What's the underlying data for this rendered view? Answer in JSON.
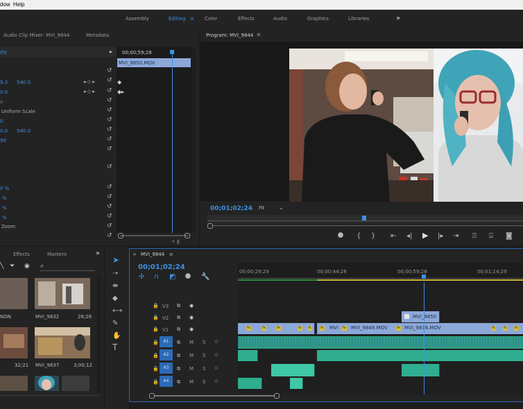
{
  "menu": {
    "items": [
      "dow",
      "Help"
    ]
  },
  "workspaces": {
    "tabs": [
      "Assembly",
      "Editing",
      "Color",
      "Effects",
      "Audio",
      "Graphics",
      "Libraries"
    ],
    "more": "»"
  },
  "effect_controls": {
    "tabs": [
      "Audio Clip Mixer: MVI_9844",
      "Metadata"
    ],
    "clip_name": "OV",
    "timecode": "00;00;59;28",
    "clip_label": "MVI_9850.MOV",
    "values": {
      "pos_x": "9.3",
      "pos_y": "540.0",
      "row2": "0",
      "row2_y": "0.0",
      "uniform": "Uniform Scale",
      "r5": "0",
      "r6a": "0.0",
      "r6b": "540.0",
      "r7": "90",
      "p1": "0 %",
      "p2": "%",
      "p3": "%",
      "p4": "%",
      "zoom": "Zoom"
    }
  },
  "program": {
    "title": "Program: MVI_9844",
    "timecode": "00;01;02;24",
    "fit": "Fit"
  },
  "project": {
    "tabs": [
      "Effects",
      "Markers"
    ],
    "more": "»",
    "items": [
      {
        "name": "NON",
        "duration": ""
      },
      {
        "name": "MVI_9832",
        "duration": "28;26"
      },
      {
        "name": "",
        "duration": "32;21"
      },
      {
        "name": "MVI_9837",
        "duration": "3;00;12"
      }
    ]
  },
  "timeline": {
    "sequence_tab": "MVI_9844",
    "timecode": "00;01;02;24",
    "ruler": [
      "00;00;29;29",
      "00;00;44;28",
      "00;00;59;28",
      "00;01;14;29"
    ],
    "video_tracks": [
      "V3",
      "V2",
      "V1"
    ],
    "audio_tracks": [
      "A1",
      "A2",
      "A3",
      "A4"
    ],
    "mute": "M",
    "solo": "S",
    "clips": {
      "v2": "MVI_9850",
      "v1a": "MVI",
      "v1b": "MVI_9849.MOV",
      "v1c": "MVI_9836.MOV",
      "fx": "fx"
    }
  },
  "colors": {
    "accent": "#3d8fe0",
    "audio_clip": "#2fae8f",
    "video_clip": "#8ca8d8",
    "playhead": "#3d8fe0"
  }
}
